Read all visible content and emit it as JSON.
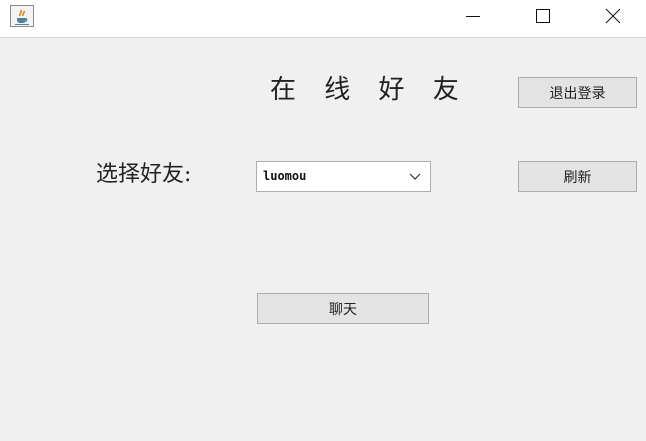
{
  "window": {
    "icon": "java-coffee-icon",
    "controls": [
      "minimize-icon",
      "maximize-icon",
      "close-icon"
    ]
  },
  "main": {
    "heading": "在 线 好 友",
    "select_label": "选择好友:",
    "friend_select": {
      "selected": "luomou"
    },
    "logout_label": "退出登录",
    "refresh_label": "刷新",
    "chat_label": "聊天"
  },
  "colors": {
    "background": "#f0f0f0",
    "button": "#e3e3e3",
    "button_border": "#adadad",
    "titlebar": "#ffffff"
  }
}
